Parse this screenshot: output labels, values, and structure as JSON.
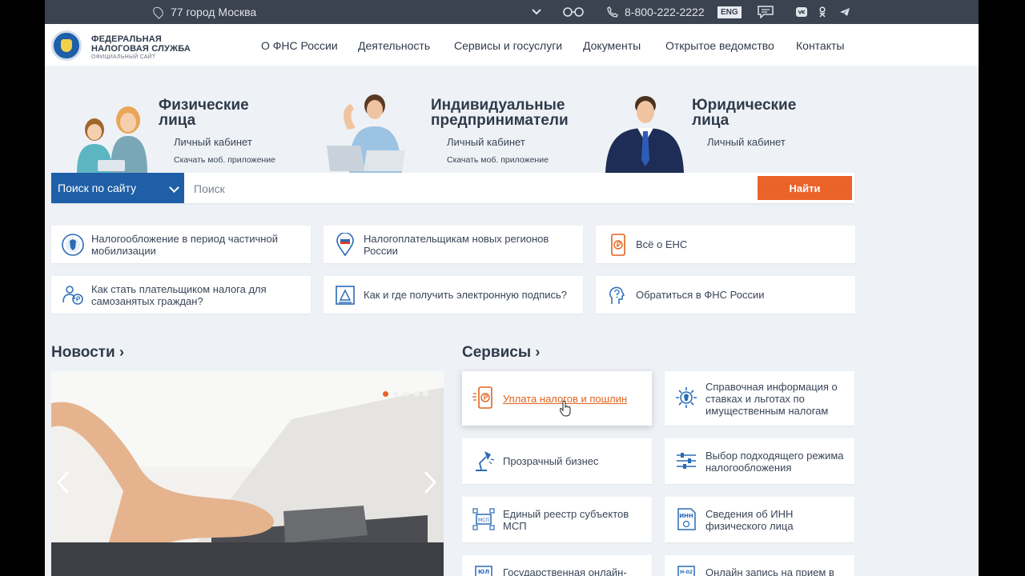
{
  "topbar": {
    "region": "77 город Москва",
    "phone": "8-800-222-2222",
    "lang": "ENG",
    "icons": [
      "location-pin-icon",
      "chevron-down-icon",
      "glasses-icon",
      "phone-icon",
      "chat-icon",
      "vk-icon",
      "ok-icon",
      "telegram-icon"
    ]
  },
  "header": {
    "logo_line1": "ФЕДЕРАЛЬНАЯ",
    "logo_line2": "НАЛОГОВАЯ СЛУЖБА",
    "logo_sub": "ОФИЦИАЛЬНЫЙ САЙТ",
    "nav": [
      "О ФНС России",
      "Деятельность",
      "Сервисы и госуслуги",
      "Документы",
      "Открытое ведомство",
      "Контакты"
    ]
  },
  "hero": [
    {
      "title1": "Физические",
      "title2": "лица",
      "link": "Личный кабинет",
      "app": "Скачать моб. приложение"
    },
    {
      "title1": "Индивидуальные",
      "title2": "предприниматели",
      "link": "Личный кабинет",
      "app": "Скачать моб. приложение"
    },
    {
      "title1": "Юридические",
      "title2": "лица",
      "link": "Личный кабинет",
      "app": ""
    }
  ],
  "search": {
    "scope": "Поиск по сайту",
    "placeholder": "Поиск",
    "button": "Найти"
  },
  "quick": [
    "Налогообложение в период частичной мобилизации",
    "Налогоплательщикам новых регионов России",
    "Всё о ЕНС",
    "Как стать плательщиком налога для самозанятых граждан?",
    "Как и где получить электронную подпись?",
    "Обратиться в ФНС России"
  ],
  "news": {
    "title": "Новости"
  },
  "services": {
    "title": "Сервисы",
    "items": [
      "Уплата налогов и пошлин",
      "Справочная информация о ставках и льготах по имущественным налогам",
      "Прозрачный бизнес",
      "Выбор подходящего режима налогообложения",
      "Единый реестр субъектов МСП",
      "Сведения об ИНН физического лица",
      "Государственная онлайн-",
      "Онлайн запись на прием в"
    ]
  },
  "colors": {
    "topbar": "#3b4250",
    "brand_blue": "#1f5fa7",
    "accent_orange": "#ea6329",
    "page_bg": "#eef2f6"
  }
}
